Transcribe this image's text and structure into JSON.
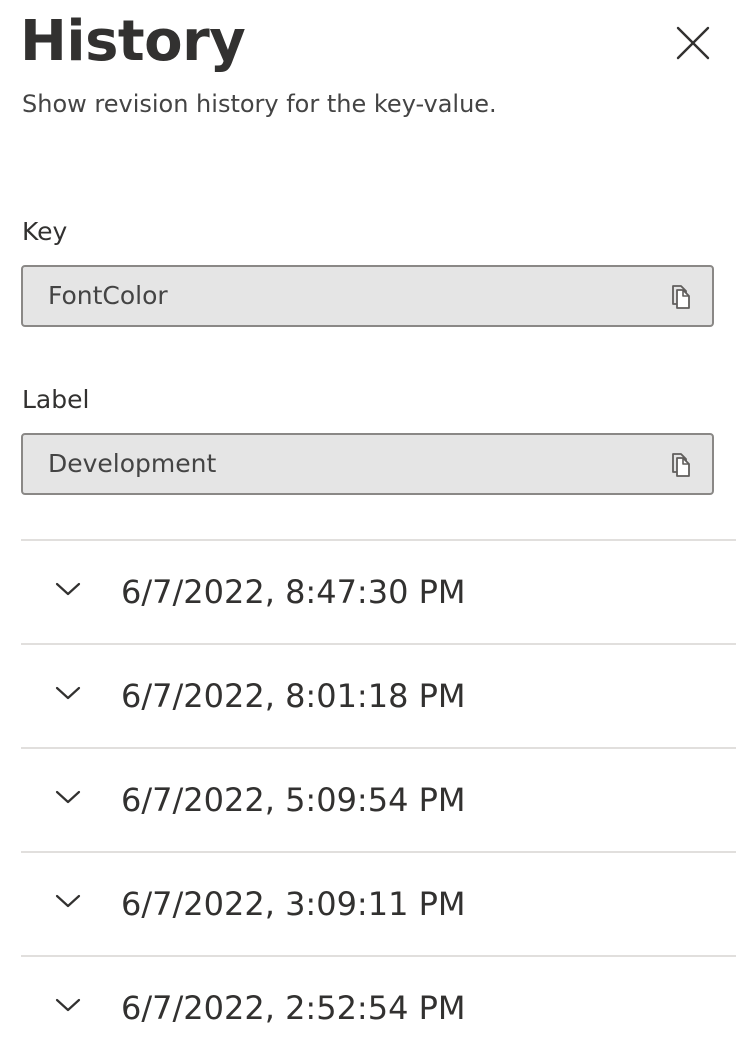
{
  "panel": {
    "title": "History",
    "subtitle": "Show revision history for the key-value.",
    "close_icon": "close-icon"
  },
  "fields": {
    "key": {
      "label": "Key",
      "value": "FontColor",
      "icon": "copy-icon"
    },
    "label": {
      "label": "Label",
      "value": "Development",
      "icon": "copy-icon"
    }
  },
  "history": {
    "icon": "chevron-down-icon",
    "items": [
      "6/7/2022, 8:47:30 PM",
      "6/7/2022, 8:01:18 PM",
      "6/7/2022, 5:09:54 PM",
      "6/7/2022, 3:09:11 PM",
      "6/7/2022, 2:52:54 PM"
    ]
  },
  "colors": {
    "text": "#323130",
    "field_background": "#e5e5e5",
    "field_border": "#8a8886",
    "divider": "#e1dfdd"
  }
}
